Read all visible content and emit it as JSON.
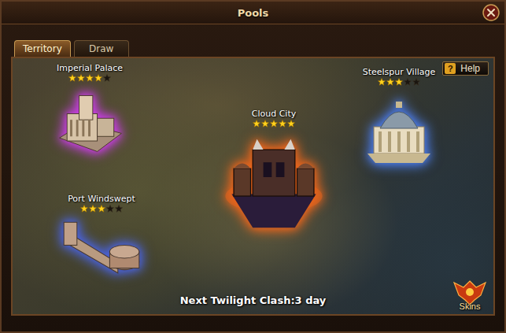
{
  "window": {
    "title": "Pools"
  },
  "tabs": [
    {
      "label": "Territory",
      "selected": true
    },
    {
      "label": "Draw",
      "selected": false
    }
  ],
  "help": {
    "icon": "?",
    "label": "Help"
  },
  "locations": [
    {
      "name": "Imperial Palace",
      "stars": 4,
      "max_stars": 5,
      "color": "#c63ee0"
    },
    {
      "name": "Cloud City",
      "stars": 5,
      "max_stars": 5,
      "color": "#e8641c"
    },
    {
      "name": "Steelspur Village",
      "stars": 3,
      "max_stars": 5,
      "color": "#4a78e0"
    },
    {
      "name": "Port Windswept",
      "stars": 3,
      "max_stars": 5,
      "color": "#4a62d8"
    }
  ],
  "status": {
    "text": "Next Twilight Clash:3 day"
  },
  "skins": {
    "label": "Skins"
  }
}
